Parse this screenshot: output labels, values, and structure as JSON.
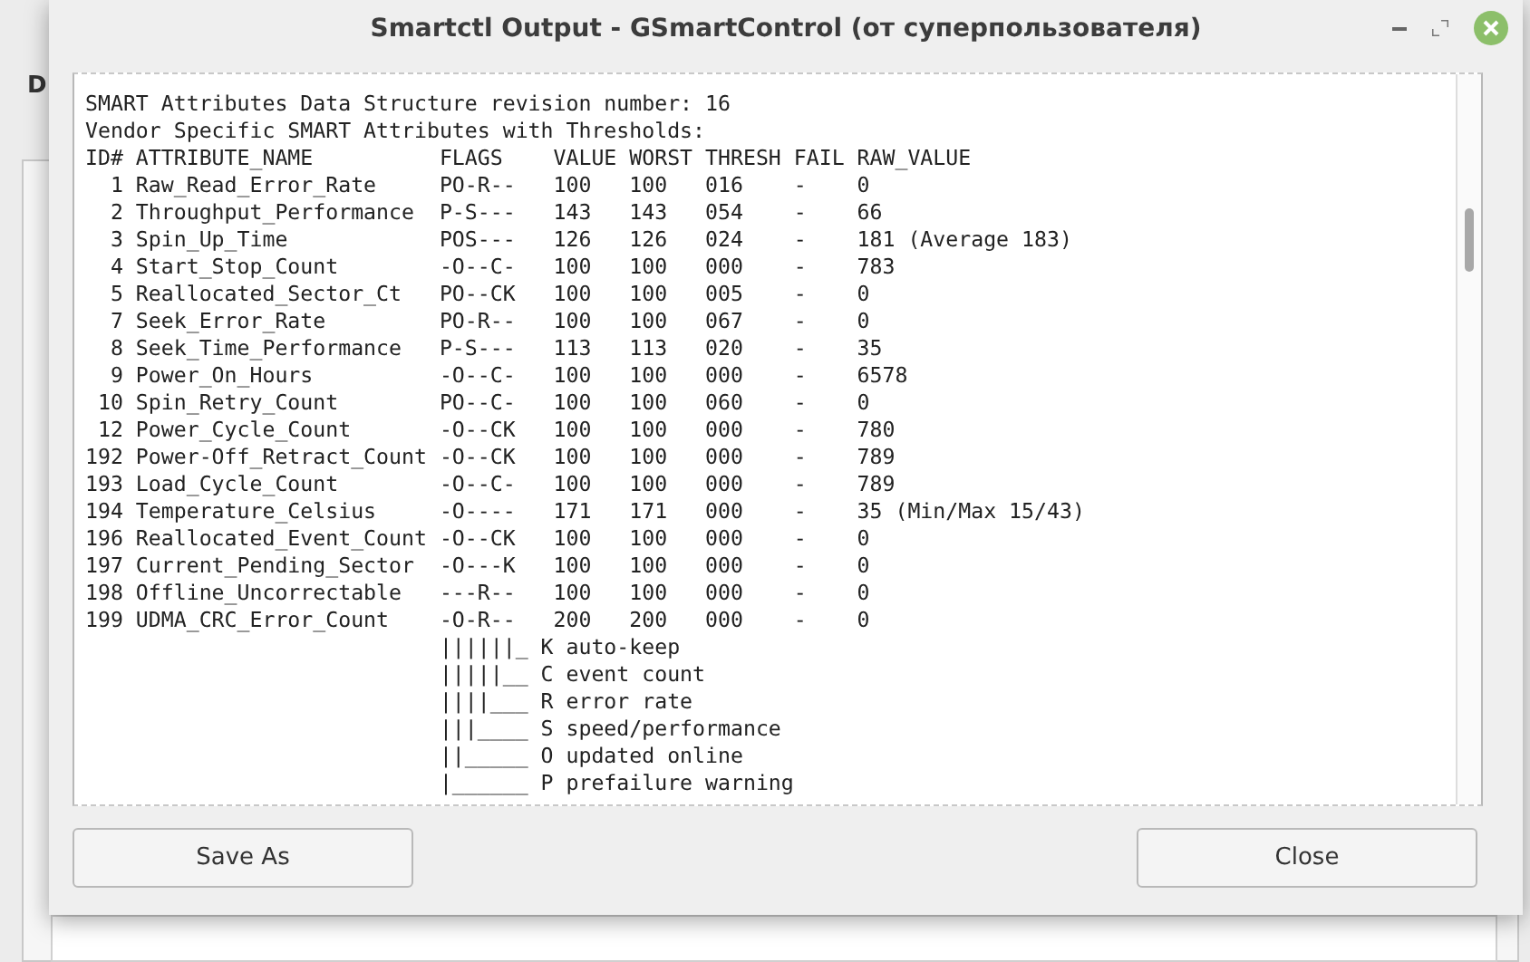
{
  "background_window": {
    "label_fragment": "D"
  },
  "window": {
    "title": "Smartctl Output - GSmartControl (от суперпользователя)"
  },
  "output": {
    "lines": [
      "SMART Attributes Data Structure revision number: 16",
      "Vendor Specific SMART Attributes with Thresholds:",
      "ID# ATTRIBUTE_NAME          FLAGS    VALUE WORST THRESH FAIL RAW_VALUE",
      "  1 Raw_Read_Error_Rate     PO-R--   100   100   016    -    0",
      "  2 Throughput_Performance  P-S---   143   143   054    -    66",
      "  3 Spin_Up_Time            POS---   126   126   024    -    181 (Average 183)",
      "  4 Start_Stop_Count        -O--C-   100   100   000    -    783",
      "  5 Reallocated_Sector_Ct   PO--CK   100   100   005    -    0",
      "  7 Seek_Error_Rate         PO-R--   100   100   067    -    0",
      "  8 Seek_Time_Performance   P-S---   113   113   020    -    35",
      "  9 Power_On_Hours          -O--C-   100   100   000    -    6578",
      " 10 Spin_Retry_Count        PO--C-   100   100   060    -    0",
      " 12 Power_Cycle_Count       -O--CK   100   100   000    -    780",
      "192 Power-Off_Retract_Count -O--CK   100   100   000    -    789",
      "193 Load_Cycle_Count        -O--C-   100   100   000    -    789",
      "194 Temperature_Celsius     -O----   171   171   000    -    35 (Min/Max 15/43)",
      "196 Reallocated_Event_Count -O--CK   100   100   000    -    0",
      "197 Current_Pending_Sector  -O---K   100   100   000    -    0",
      "198 Offline_Uncorrectable   ---R--   100   100   000    -    0",
      "199 UDMA_CRC_Error_Count    -O-R--   200   200   000    -    0",
      "                            ||||||_ K auto-keep",
      "                            |||||__ C event count",
      "                            ||||___ R error rate",
      "                            |||____ S speed/performance",
      "                            ||_____ O updated online",
      "                            |______ P prefailure warning"
    ]
  },
  "buttons": [
    {
      "label": "Save As"
    },
    {
      "label": "Close"
    }
  ]
}
